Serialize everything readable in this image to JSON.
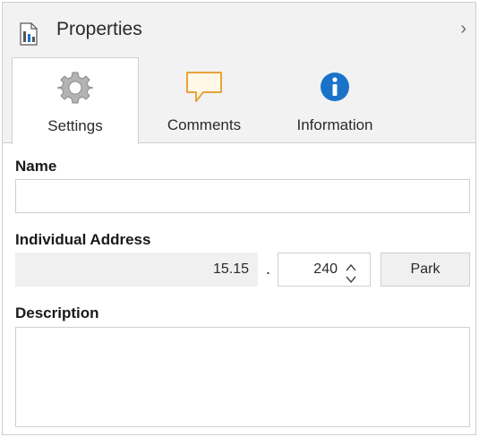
{
  "panel": {
    "title": "Properties",
    "collapse_glyph": "›"
  },
  "tabs": [
    {
      "label": "Settings",
      "icon": "gear-icon",
      "active": true
    },
    {
      "label": "Comments",
      "icon": "comment-icon",
      "active": false
    },
    {
      "label": "Information",
      "icon": "info-icon",
      "active": false
    }
  ],
  "fields": {
    "name": {
      "label": "Name",
      "value": ""
    },
    "address": {
      "label": "Individual Address",
      "prefix": "15.15",
      "separator": ".",
      "device": "240",
      "park_label": "Park"
    },
    "description": {
      "label": "Description",
      "value": ""
    }
  },
  "colors": {
    "info_blue": "#1a73c9",
    "comment_orange": "#e8a33a",
    "comment_fill": "#fff7e8"
  }
}
